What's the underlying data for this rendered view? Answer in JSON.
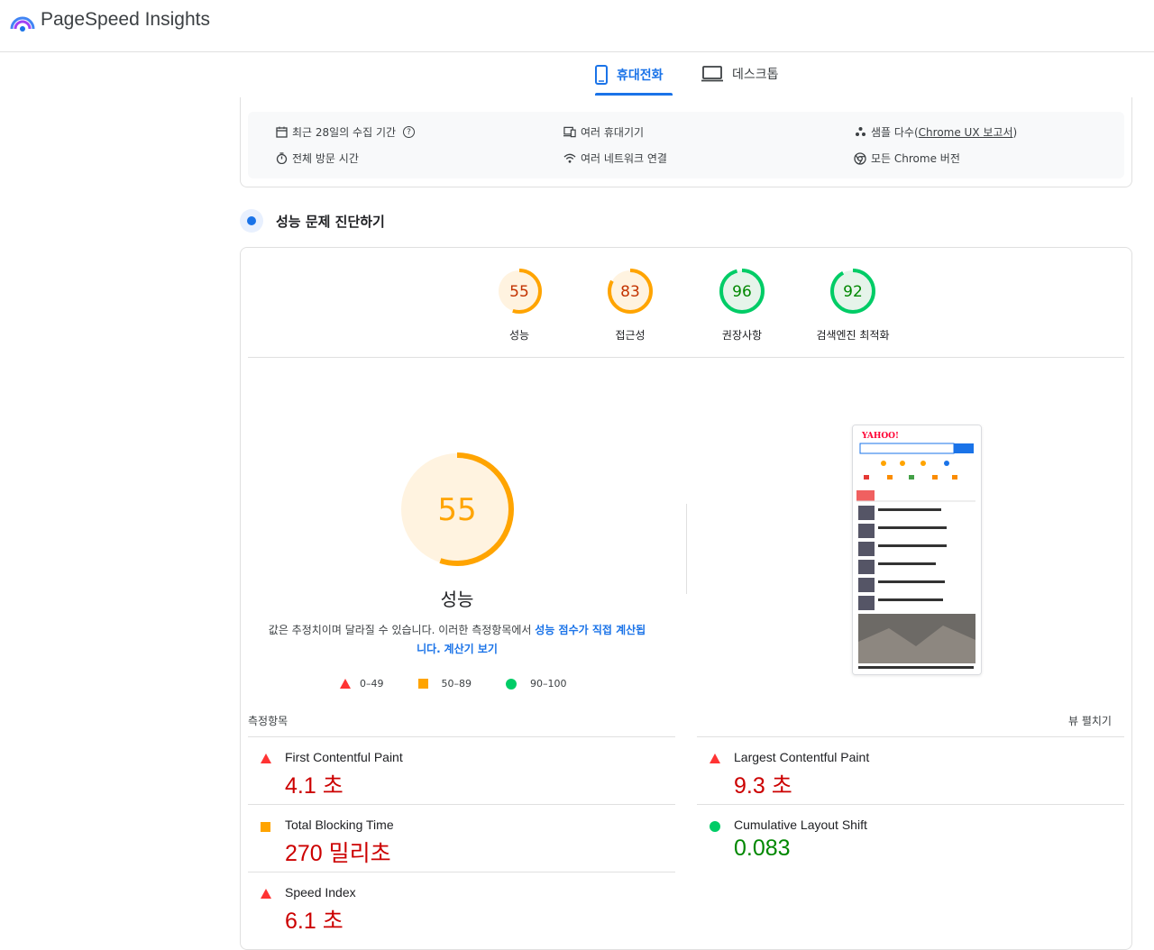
{
  "header": {
    "title": "PageSpeed Insights"
  },
  "tabs": {
    "mobile": "휴대전화",
    "desktop": "데스크톱"
  },
  "info": {
    "collection_period": "최근 28일의 수집 기간",
    "devices": "여러 휴대기기",
    "samples_prefix": "샘플 다수(",
    "samples_link": "Chrome UX 보고서",
    "samples_suffix": ")",
    "visit_duration": "전체 방문 시간",
    "network": "여러 네트워크 연결",
    "chrome_versions": "모든 Chrome 버전"
  },
  "diagnose": {
    "title": "성능 문제 진단하기"
  },
  "scores": [
    {
      "value": "55",
      "label": "성능",
      "color": "#ffa400",
      "status": "average"
    },
    {
      "value": "83",
      "label": "접근성",
      "color": "#ffa400",
      "status": "average"
    },
    {
      "value": "96",
      "label": "권장사항",
      "color": "#0c6",
      "status": "pass"
    },
    {
      "value": "92",
      "label": "검색엔진 최적화",
      "color": "#0c6",
      "status": "pass"
    }
  ],
  "performance": {
    "score": "55",
    "label": "성능",
    "desc_text": "값은 추정치이며 달라질 수 있습니다. 이러한 측정항목에서 ",
    "desc_link": "성능 점수가 직접 계산됩니다.",
    "calc_link": "계산기 보기",
    "legend": {
      "fail": "0–49",
      "average": "50–89",
      "pass": "90–100"
    }
  },
  "metrics": {
    "heading": "측정항목",
    "expand": "뷰 펼치기",
    "items": [
      {
        "name": "First Contentful Paint",
        "value": "4.1 초",
        "status": "fail"
      },
      {
        "name": "Largest Contentful Paint",
        "value": "9.3 초",
        "status": "fail"
      },
      {
        "name": "Total Blocking Time",
        "value": "270 밀리초",
        "status": "average"
      },
      {
        "name": "Cumulative Layout Shift",
        "value": "0.083",
        "status": "pass"
      },
      {
        "name": "Speed Index",
        "value": "6.1 초",
        "status": "fail"
      }
    ]
  },
  "colors": {
    "accent": "#1a73e8",
    "fail": "#ff3333",
    "average": "#ffa400",
    "pass": "#00cc66"
  }
}
